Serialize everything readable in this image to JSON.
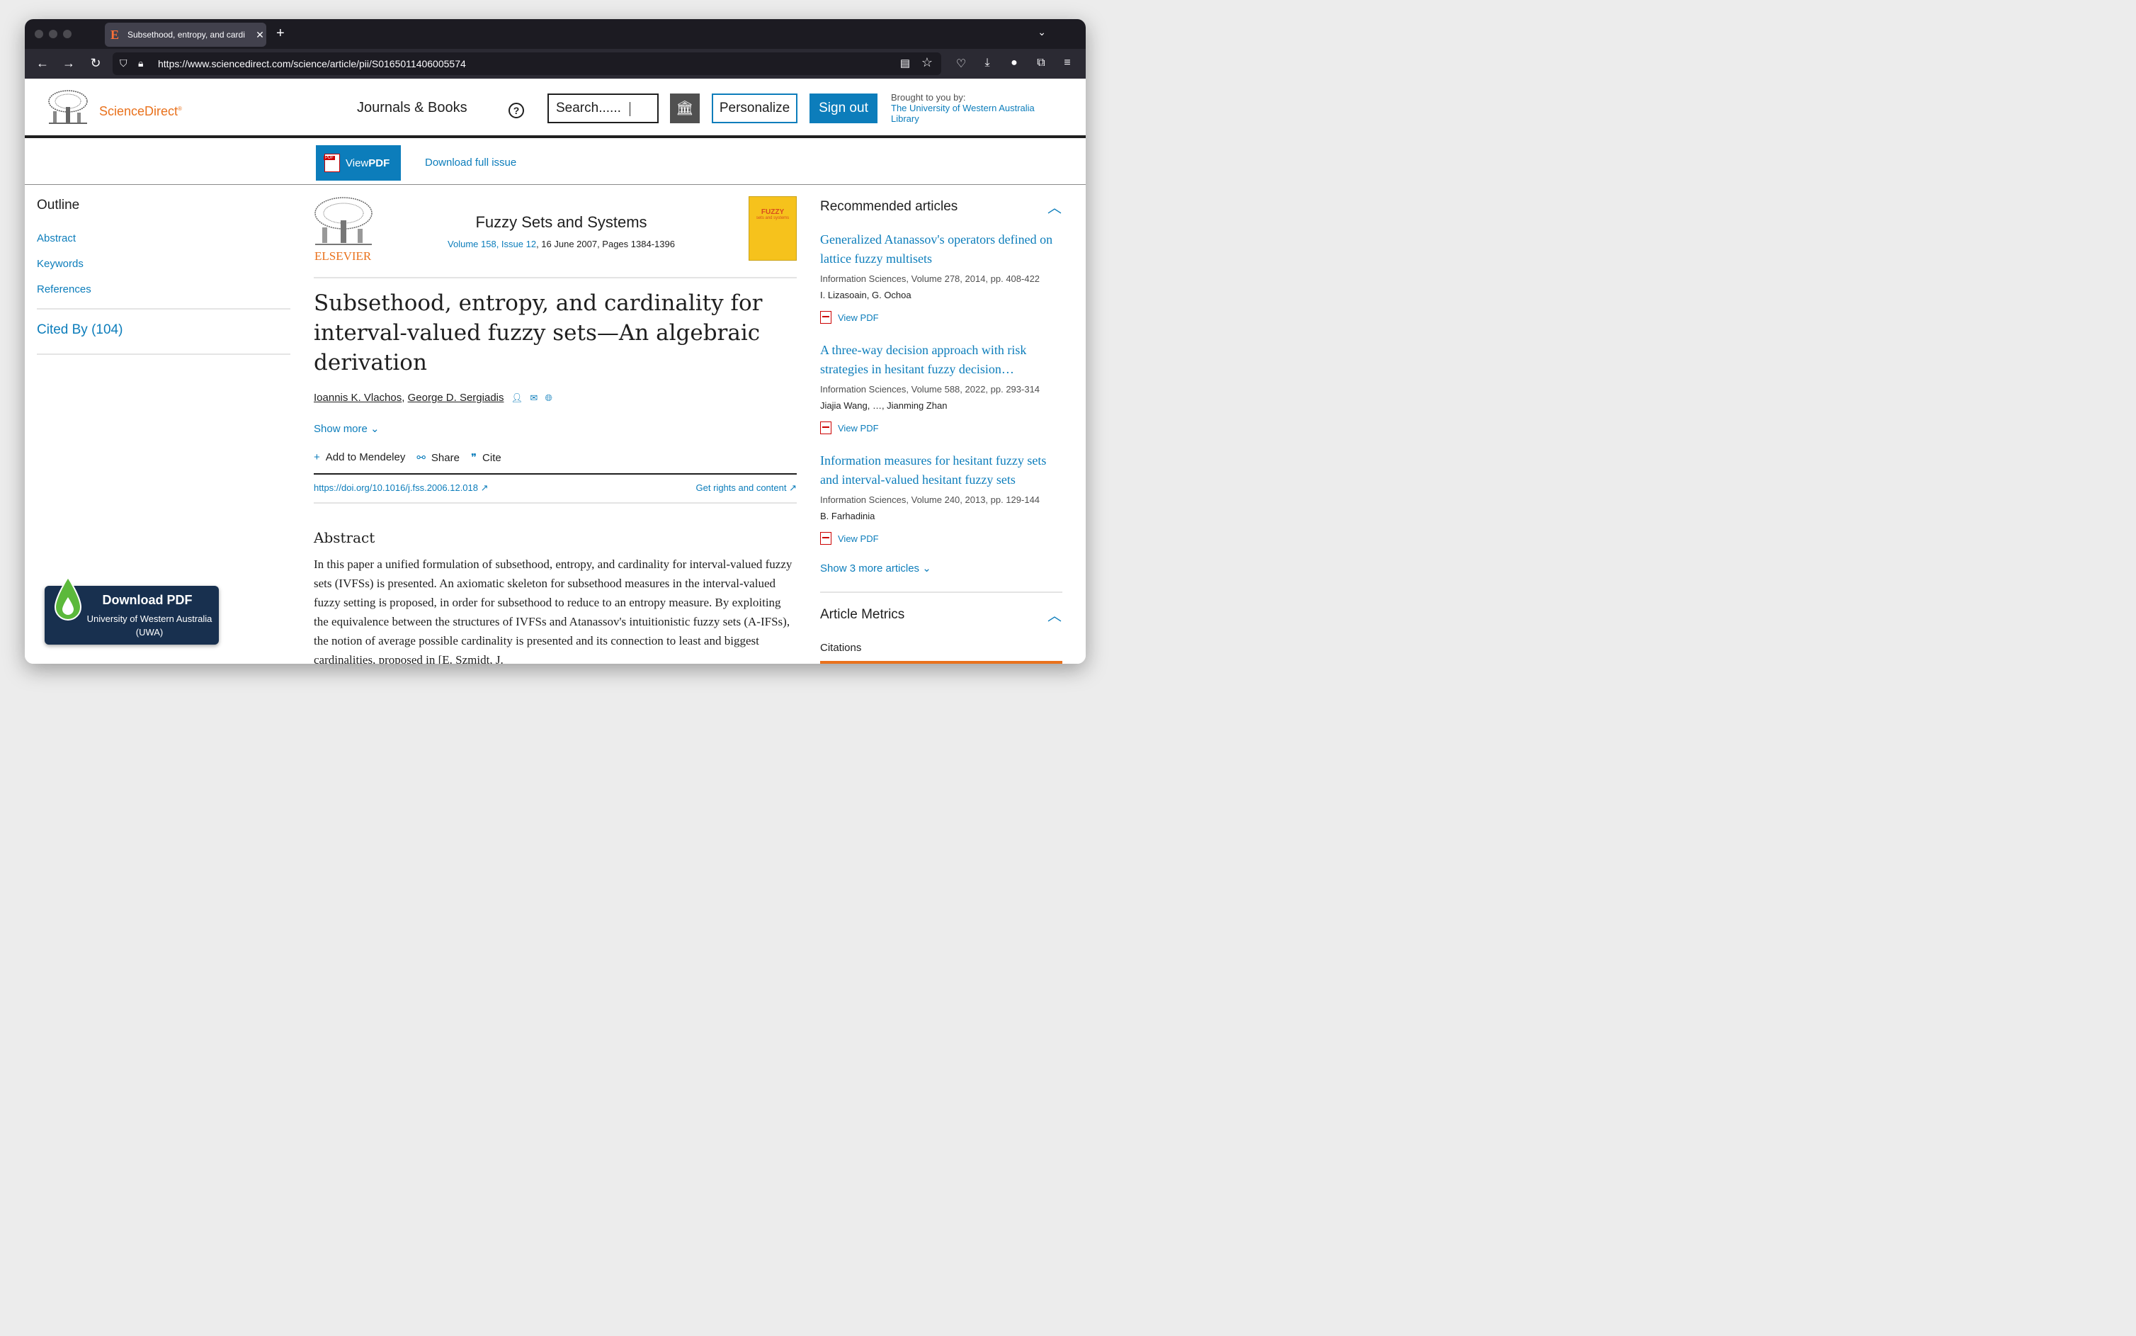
{
  "browser": {
    "tab_title": "Subsethood, entropy, and cardi",
    "url": "https://www.sciencedirect.com/science/article/pii/S0165011406005574"
  },
  "header": {
    "brand": "ScienceDirect",
    "brand_reg": "®",
    "journals_books": "Journals & Books",
    "help": "?",
    "search_placeholder": "Search......",
    "personalize": "Personalize",
    "sign_out": "Sign out",
    "brought_by": "Brought to you by:",
    "library_line1": "The University of Western Australia",
    "library_line2": "Library"
  },
  "pdfbar": {
    "view_pdf_a": "View ",
    "view_pdf_b": "PDF",
    "download_issue": "Download full issue"
  },
  "outline": {
    "heading": "Outline",
    "items": [
      "Abstract",
      "Keywords",
      "References"
    ],
    "cited_by": "Cited By (104)"
  },
  "download_widget": {
    "title": "Download PDF",
    "line1": "University of Western Australia",
    "line2": "(UWA)"
  },
  "article": {
    "publisher": "ELSEVIER",
    "journal": "Fuzzy Sets and Systems",
    "volume_link": "Volume 158, Issue 12",
    "volume_rest": ", 16 June 2007, Pages 1384-1396",
    "cover_title": "FUZZY",
    "cover_sub": "sets and systems",
    "title": "Subsethood, entropy, and cardinality for interval-valued fuzzy sets—An algebraic derivation",
    "author1": "Ioannis K. Vlachos",
    "sep": ", ",
    "author2": "George D. Sergiadis",
    "show_more": "Show more",
    "add_mendeley": "Add to Mendeley",
    "share": "Share",
    "cite": "Cite",
    "doi": "https://doi.org/10.1016/j.fss.2006.12.018",
    "rights": "Get rights and content",
    "abstract_heading": "Abstract",
    "abstract_text": "In this paper a unified formulation of subsethood, entropy, and cardinality for interval-valued fuzzy sets (IVFSs) is presented. An axiomatic skeleton for subsethood measures in the interval-valued fuzzy setting is proposed, in order for subsethood to reduce to an entropy measure. By exploiting the equivalence between the structures of IVFSs and Atanassov's intuitionistic fuzzy sets (A-IFSs), the notion of average possible cardinality is presented and its connection to least and biggest cardinalities, proposed in [E. Szmidt, J."
  },
  "recommended": {
    "heading": "Recommended articles",
    "view_pdf": "View PDF",
    "items": [
      {
        "title": "Generalized Atanassov's operators defined on lattice fuzzy multisets",
        "source": "Information Sciences, Volume 278, 2014, pp. 408-422",
        "authors": "I. Lizasoain, G. Ochoa"
      },
      {
        "title": "A three-way decision approach with risk strategies in hesitant fuzzy decision…",
        "source": "Information Sciences, Volume 588, 2022, pp. 293-314",
        "authors": "Jiajia Wang, …, Jianming Zhan"
      },
      {
        "title": "Information measures for hesitant fuzzy sets and interval-valued hesitant fuzzy sets",
        "source": "Information Sciences, Volume 240, 2013, pp. 129-144",
        "authors": "B. Farhadinia"
      }
    ],
    "show_more": "Show 3 more articles"
  },
  "metrics": {
    "heading": "Article Metrics",
    "citations": "Citations"
  },
  "colors": {
    "accent": "#0c7dbb",
    "brand_orange": "#e9711c",
    "widget_bg": "#18304f"
  }
}
